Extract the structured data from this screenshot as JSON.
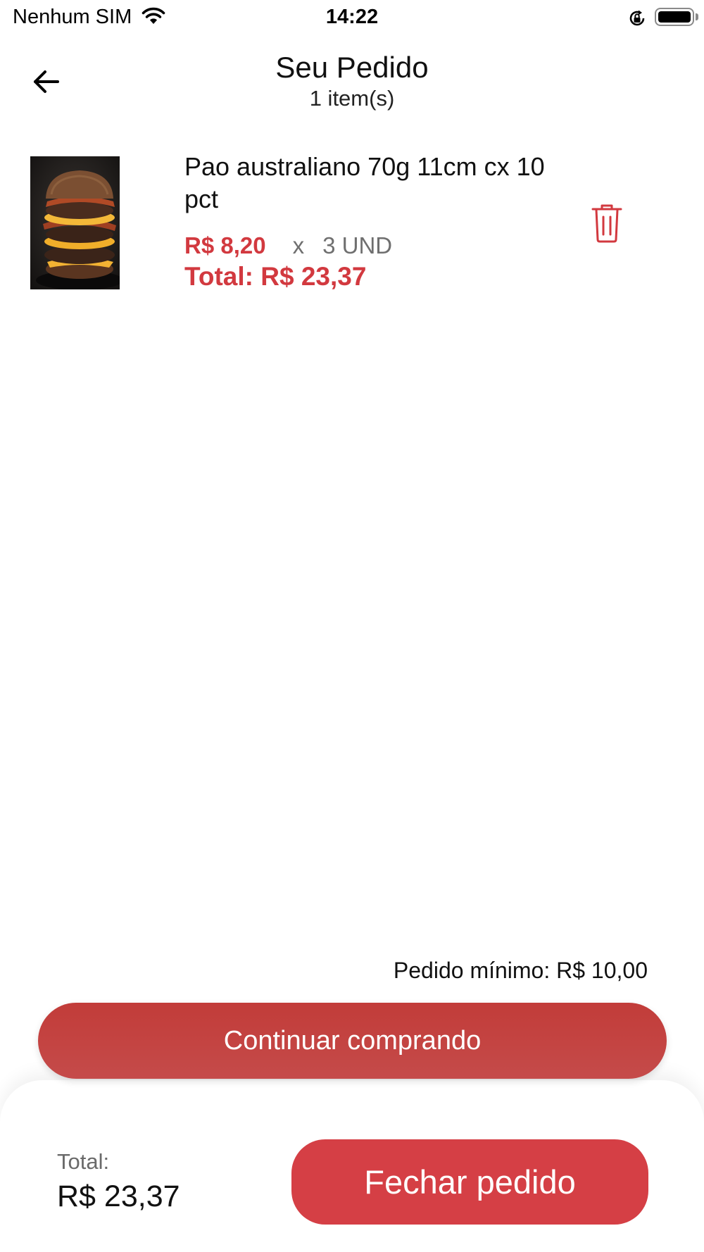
{
  "status_bar": {
    "carrier": "Nenhum SIM",
    "time": "14:22",
    "icons": [
      "wifi-icon",
      "rotation-lock-icon",
      "battery-icon"
    ]
  },
  "header": {
    "back_icon": "arrow-left-icon",
    "title": "Seu Pedido",
    "subtitle": "1 item(s)"
  },
  "cart": {
    "items": [
      {
        "image": "burger-photo",
        "name": "Pao australiano 70g 11cm cx 10 pct",
        "unit_price": "R$ 8,20",
        "times": "x",
        "quantity": "3 UND",
        "total": "Total: R$ 23,37",
        "delete_icon": "trash-icon"
      }
    ]
  },
  "footer": {
    "minimum_order": "Pedido mínimo: R$ 10,00",
    "continue_label": "Continuar comprando",
    "total_label": "Total:",
    "total_value": "R$ 23,37",
    "checkout_label": "Fechar pedido"
  },
  "colors": {
    "accent": "#d2393f",
    "continue_button": "#c23c39",
    "checkout_button": "#d53f45"
  }
}
